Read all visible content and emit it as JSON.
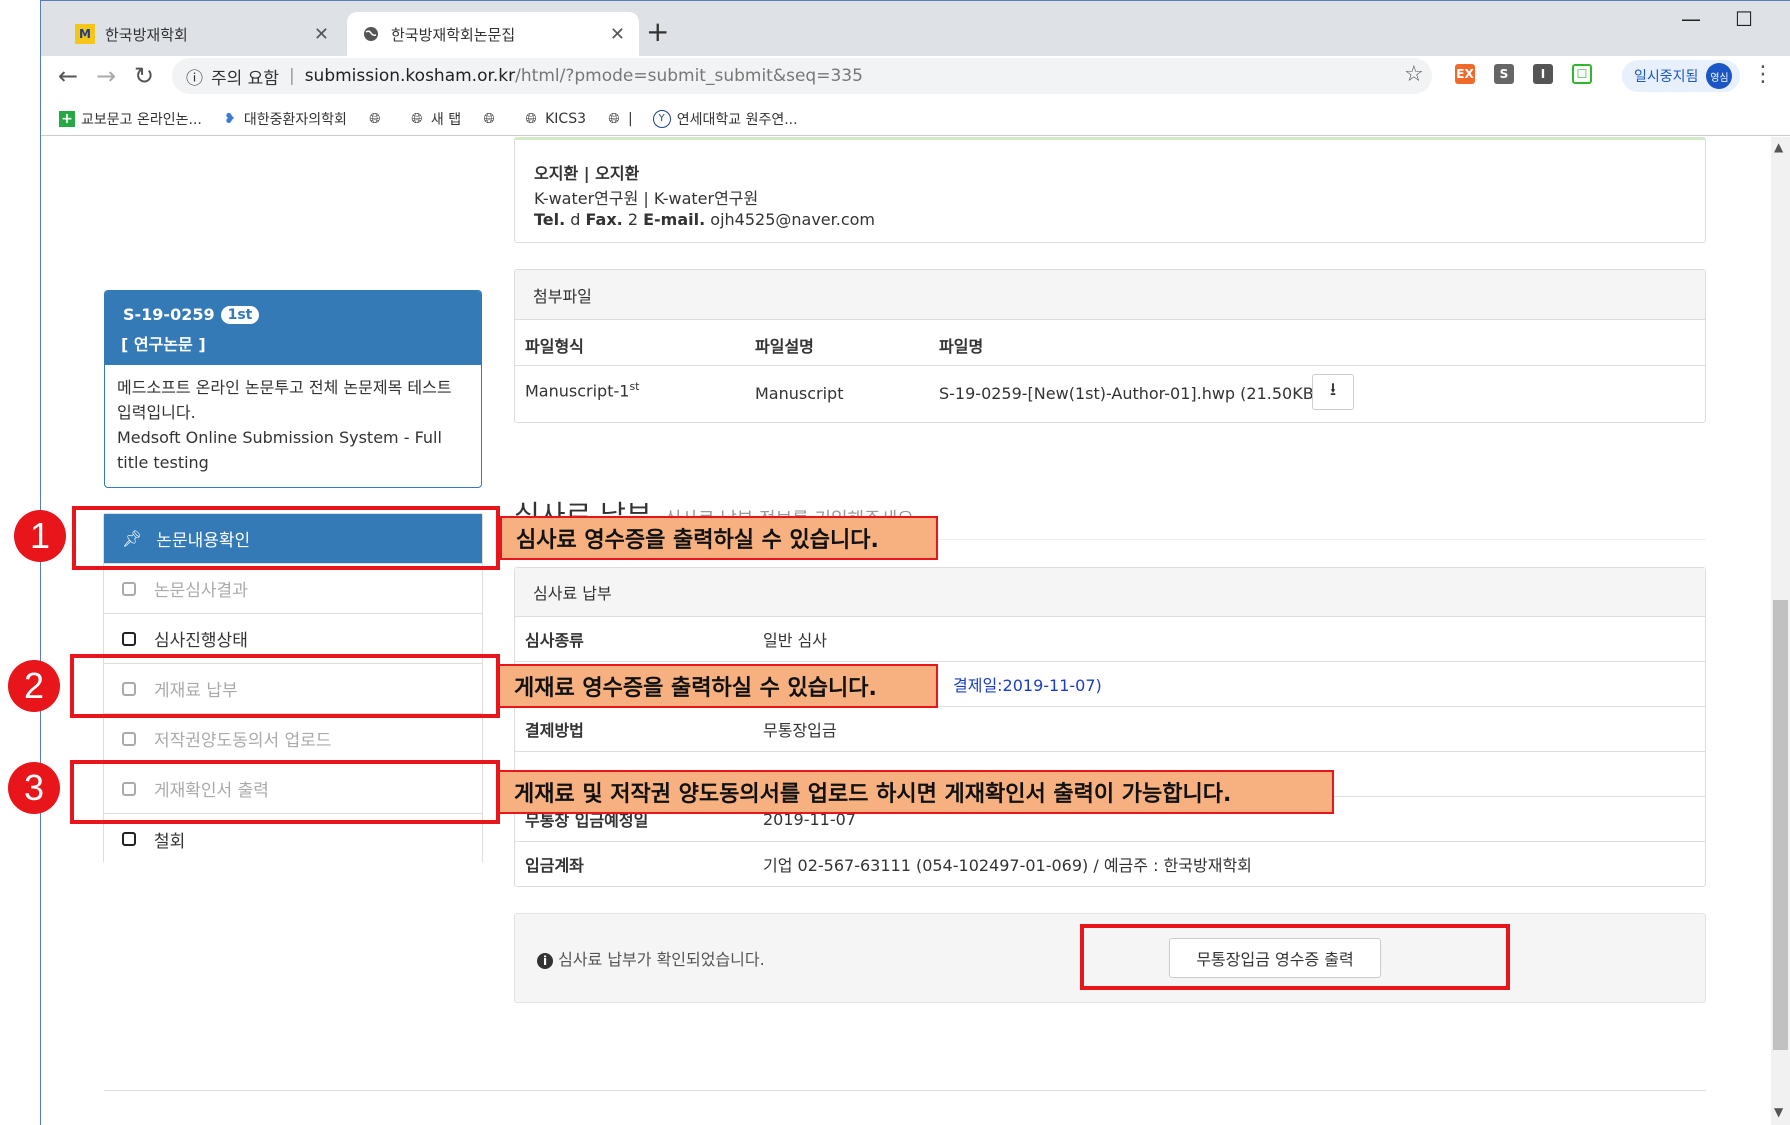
{
  "browser": {
    "tabs": [
      {
        "title": "한국방재학회",
        "favicon": "M"
      },
      {
        "title": "한국방재학회논문집"
      }
    ],
    "new_tab": "+",
    "security_label": "주의 요함",
    "url_host": "submission.kosham.or.kr",
    "url_path": "/html/?pmode=submit_submit&seq=335",
    "extensions": [
      "EX",
      "S",
      "I",
      "☐"
    ],
    "profile_label": "일시중지됨",
    "profile_avatar": "영심",
    "bookmarks": [
      "교보문고 온라인논...",
      "대한중환자의학회",
      "",
      "새 탭",
      "",
      "KICS3",
      "|",
      "연세대학교 원주연..."
    ]
  },
  "author": {
    "name": "오지환 | 오지환",
    "affiliation": "K-water연구원 | K-water연구원",
    "tel_label": "Tel.",
    "tel_value": "d",
    "fax_label": "Fax.",
    "fax_value": "2",
    "email_label": "E-mail.",
    "email_value": "ojh4525@naver.com"
  },
  "attachments": {
    "title": "첨부파일",
    "headers": [
      "파일형식",
      "파일설명",
      "파일명"
    ],
    "rows": [
      {
        "type": "Manuscript-1",
        "type_sup": "st",
        "desc": "Manuscript",
        "file": "S-19-0259-[New(1st)-Author-01].hwp (21.50KB)"
      }
    ]
  },
  "fee_section": {
    "title": "심사료 납부",
    "subtitle": "심사료 납부 정보를 기입해주세요"
  },
  "sidebar": {
    "paper_id": "S-19-0259",
    "badge": "1st",
    "category": "[ 연구논문 ]",
    "paper_title_ko": "메드소프트 온라인 논문투고 전체 논문제목 테스트 입력입니다.",
    "paper_title_en": "Medsoft Online Submission System - Full title testing",
    "menu": [
      {
        "label": "논문내용확인",
        "state": "active"
      },
      {
        "label": "논문심사결과",
        "state": "disabled"
      },
      {
        "label": "심사진행상태",
        "state": "enabled"
      },
      {
        "label": "게재료 납부",
        "state": "disabled"
      },
      {
        "label": "저작권양도동의서 업로드",
        "state": "disabled"
      },
      {
        "label": "게재확인서 출력",
        "state": "disabled"
      },
      {
        "label": "철회",
        "state": "enabled"
      }
    ]
  },
  "fee_panel": {
    "title": "심사료 납부",
    "rows": [
      {
        "key": "심사종류",
        "value": "일반 심사"
      },
      {
        "key": "",
        "value": "결제일:2019-11-07)"
      },
      {
        "key": "결제방법",
        "value": "무통장입금"
      },
      {
        "key": "",
        "value": ""
      },
      {
        "key": "무통장 입금예정일",
        "value": "2019-11-07"
      },
      {
        "key": "입금계좌",
        "value": "기업 02-567-63111 (054-102497-01-069) / 예금주 : 한국방재학회"
      }
    ]
  },
  "confirm": {
    "message": "심사료 납부가 확인되었습니다.",
    "print_button": "무통장입금 영수증 출력"
  },
  "annotations": [
    {
      "number": "1",
      "text": "심사료 영수증을 출력하실 수 있습니다."
    },
    {
      "number": "2",
      "text": "게재료 영수증을 출력하실 수 있습니다."
    },
    {
      "number": "3",
      "text": "게재료 및 저작권 양도동의서를 업로드 하시면 게재확인서 출력이 가능합니다."
    }
  ],
  "colors": {
    "primary": "#337ab7",
    "annotation_red": "#e8151b",
    "callout_fill": "#f7b180"
  }
}
